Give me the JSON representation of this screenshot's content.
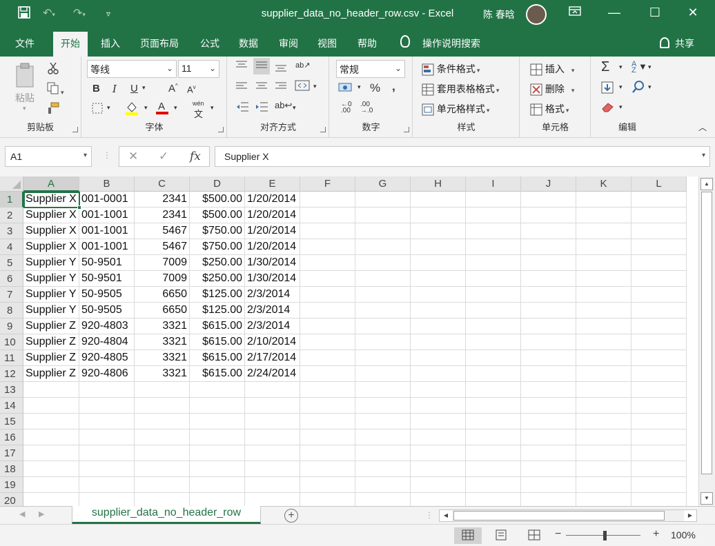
{
  "titlebar": {
    "title": "supplier_data_no_header_row.csv  -  Excel",
    "user": "陈 春晗",
    "save_icon": "save-icon",
    "undo_icon": "undo-icon",
    "redo_icon": "redo-icon",
    "customize_icon": "customize-quick-access-icon"
  },
  "tabs": {
    "items": [
      "文件",
      "开始",
      "插入",
      "页面布局",
      "公式",
      "数据",
      "审阅",
      "视图",
      "帮助"
    ],
    "active": "开始",
    "tell_me": "操作说明搜索",
    "share": "共享"
  },
  "ribbon": {
    "clipboard": {
      "label": "剪贴板",
      "paste": "粘贴"
    },
    "font": {
      "label": "字体",
      "font_name": "等线",
      "font_size": "11",
      "bold": "B",
      "italic": "I",
      "underline": "U",
      "wen": "wén"
    },
    "alignment": {
      "label": "对齐方式"
    },
    "number": {
      "label": "数字",
      "format": "常规",
      "percent": "%",
      "comma": ",",
      "inc_decimal": ".00",
      "dec_decimal": ".0"
    },
    "styles": {
      "label": "样式",
      "conditional": "条件格式",
      "table_format": "套用表格格式",
      "cell_styles": "单元格样式"
    },
    "cells": {
      "label": "单元格",
      "insert": "插入",
      "delete": "删除",
      "format": "格式"
    },
    "editing": {
      "label": "编辑"
    }
  },
  "formula_bar": {
    "name_box": "A1",
    "cancel": "✕",
    "enter": "✓",
    "fx": "fx",
    "content": "Supplier X"
  },
  "sheet": {
    "columns": [
      "A",
      "B",
      "C",
      "D",
      "E",
      "F",
      "G",
      "H",
      "I",
      "J",
      "K",
      "L"
    ],
    "row_numbers": [
      "1",
      "2",
      "3",
      "4",
      "5",
      "6",
      "7",
      "8",
      "9",
      "10",
      "11",
      "12",
      "13",
      "14",
      "15",
      "16",
      "17",
      "18",
      "19",
      "20"
    ],
    "selected_cell": "A1",
    "rows": [
      [
        "Supplier X",
        "001-0001",
        "2341",
        "$500.00",
        "1/20/2014"
      ],
      [
        "Supplier X",
        "001-1001",
        "2341",
        "$500.00",
        "1/20/2014"
      ],
      [
        "Supplier X",
        "001-1001",
        "5467",
        "$750.00",
        "1/20/2014"
      ],
      [
        "Supplier X",
        "001-1001",
        "5467",
        "$750.00",
        "1/20/2014"
      ],
      [
        "Supplier Y",
        "50-9501",
        "7009",
        "$250.00",
        "1/30/2014"
      ],
      [
        "Supplier Y",
        "50-9501",
        "7009",
        "$250.00",
        "1/30/2014"
      ],
      [
        "Supplier Y",
        "50-9505",
        "6650",
        "$125.00",
        "2/3/2014"
      ],
      [
        "Supplier Y",
        "50-9505",
        "6650",
        "$125.00",
        "2/3/2014"
      ],
      [
        "Supplier Z",
        "920-4803",
        "3321",
        "$615.00",
        "2/3/2014"
      ],
      [
        "Supplier Z",
        "920-4804",
        "3321",
        "$615.00",
        "2/10/2014"
      ],
      [
        "Supplier Z",
        "920-4805",
        "3321",
        "$615.00",
        "2/17/2014"
      ],
      [
        "Supplier Z",
        "920-4806",
        "3321",
        "$615.00",
        "2/24/2014"
      ]
    ]
  },
  "sheet_tabs": {
    "active_sheet": "supplier_data_no_header_row",
    "add_icon": "add-sheet-icon"
  },
  "statusbar": {
    "zoom": "100%",
    "views": [
      "normal-view-icon",
      "page-layout-icon",
      "page-break-preview-icon"
    ]
  },
  "colors": {
    "accent": "#217346",
    "ribbon_bg": "#f3f3f3",
    "grid_line": "#dadada"
  }
}
